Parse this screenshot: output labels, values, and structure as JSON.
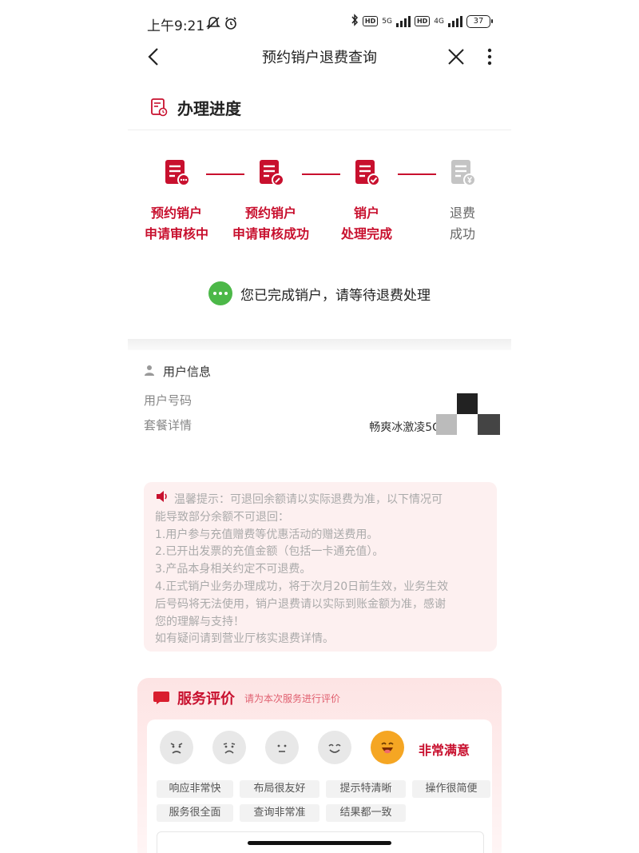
{
  "status_bar": {
    "time": "上午9:21",
    "network_5g": "5G",
    "network_4g": "4G",
    "hd_1": "HD",
    "hd_2": "HD",
    "battery": "37"
  },
  "nav": {
    "title": "预约销户退费查询"
  },
  "progress": {
    "title": "办理进度",
    "steps": [
      {
        "line1": "预约销户",
        "line2": "申请审核中",
        "state": "done",
        "icon": "document-more-icon"
      },
      {
        "line1": "预约销户",
        "line2": "申请审核成功",
        "state": "done",
        "icon": "document-edit-icon"
      },
      {
        "line1": "销户",
        "line2": "处理完成",
        "state": "done",
        "icon": "document-check-icon"
      },
      {
        "line1": "退费",
        "line2": "成功",
        "state": "pending",
        "icon": "document-yen-icon"
      }
    ],
    "message": "您已完成销户，请等待退费处理"
  },
  "user_info": {
    "title": "用户信息",
    "phone_label": "用户号码",
    "package_label": "套餐详情",
    "package_value": "畅爽冰激凌5G套餐"
  },
  "tips": {
    "lines": [
      "温馨提示：可退回余额请以实际退费为准，以下情况可",
      "能导致部分余额不可退回：",
      "1.用户参与充值赠费等优惠活动的赠送费用。",
      "2.已开出发票的充值金额（包括一卡通充值）。",
      "3.产品本身相关约定不可退费。",
      "4.正式销户业务办理成功，将于次月20日前生效，业务生效",
      "后号码将无法使用，销户退费请以实际到账金额为准，感谢",
      "您的理解与支持！",
      "如有疑问请到营业厅核实退费详情。"
    ]
  },
  "evaluation": {
    "title": "服务评价",
    "subtitle": "请为本次服务进行评价",
    "rating_label": "非常满意",
    "tags": [
      "响应非常快",
      "布局很友好",
      "提示特清晰",
      "操作很简便",
      "服务很全面",
      "查询非常准",
      "结果都一致"
    ]
  },
  "colors": {
    "brand_red": "#c8102e",
    "success_green": "#4cb848",
    "pending_gray": "#999999"
  }
}
